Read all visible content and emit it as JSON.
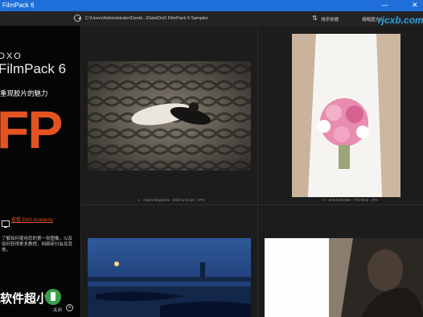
{
  "window": {
    "title": "FilmPack 6",
    "controls": {
      "minimize": "—",
      "close": "✕"
    }
  },
  "toolbar": {
    "path": "C:\\Users\\Administrator\\Deskt...\\Data\\DxO FilmPack 6 Samples",
    "sort_label": "排序依据",
    "thumb_label": "缩略图大小"
  },
  "sidebar": {
    "brand": "DXO",
    "product": "FilmPack 6",
    "tagline": "重现胶片的魅力",
    "big_letters": "FP",
    "academy_link": "查看 DxO Academy",
    "academy_desc": "了解如何使用您的第一张图像，以及如何获得更多教程，网络研讨会及其他。",
    "watermark_text": "软件超小",
    "close_label": "关闭"
  },
  "watermarks": {
    "site": "rjcxb.com"
  },
  "photos": [
    {
      "caption": "1 - Andrea Bagnasco - Bride & Groom - JPG"
    },
    {
      "caption": "2 - Jens Schlenker - The bride - JPG"
    },
    {
      "caption": ""
    },
    {
      "caption": ""
    }
  ],
  "colors": {
    "accent": "#e4531f",
    "titlebar": "#1e6fd9",
    "badge": "#3aa04a"
  }
}
